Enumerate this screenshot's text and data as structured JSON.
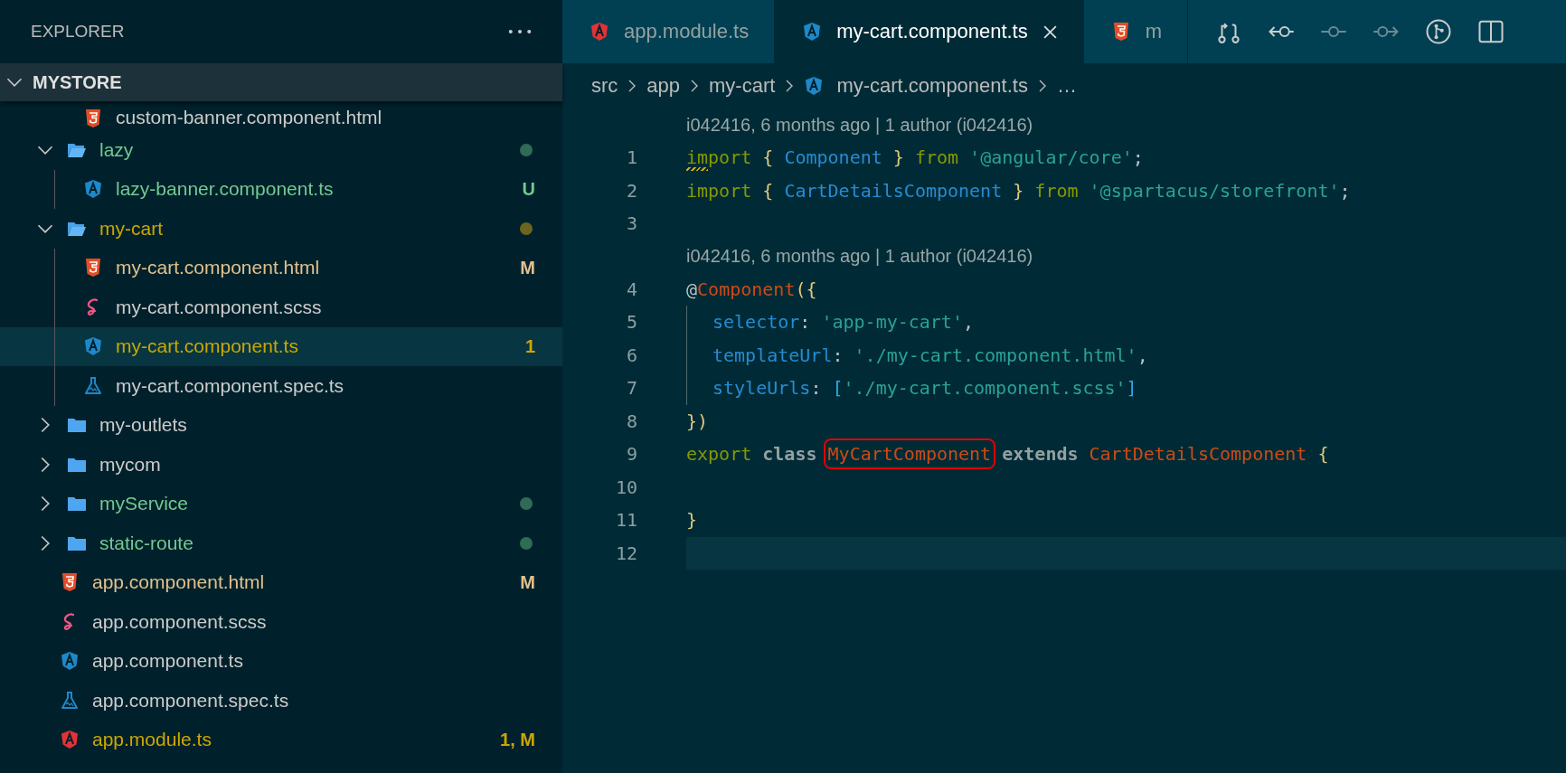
{
  "sidebar": {
    "title": "EXPLORER",
    "root": {
      "label": "MYSTORE",
      "expanded": true
    },
    "scrolled_item": {
      "label": "custom-banner.component.html",
      "kind": "html"
    },
    "tree": [
      {
        "kind": "folder",
        "label": "lazy",
        "expanded": true,
        "selected": false,
        "untracked": true,
        "modified": false,
        "has_problem": false,
        "children": [
          {
            "kind": "angular",
            "label": "lazy-banner.component.ts",
            "selected": false,
            "untracked": true,
            "modified": false,
            "has_problem": false,
            "badge": "U"
          }
        ]
      },
      {
        "kind": "folder",
        "label": "my-cart",
        "expanded": true,
        "selected": false,
        "has_problem": true,
        "children": [
          {
            "kind": "html",
            "label": "my-cart.component.html",
            "selected": false,
            "modified": true,
            "has_problem": false,
            "badge": "M"
          },
          {
            "kind": "scss",
            "label": "my-cart.component.scss",
            "selected": false,
            "untracked": false,
            "modified": false,
            "has_problem": false
          },
          {
            "kind": "angular",
            "label": "my-cart.component.ts",
            "selected": true,
            "has_problem": true,
            "badge": "1"
          },
          {
            "kind": "test",
            "label": "my-cart.component.spec.ts",
            "selected": false,
            "untracked": false,
            "modified": false,
            "has_problem": false
          }
        ]
      },
      {
        "kind": "folder",
        "label": "my-outlets",
        "expanded": false,
        "selected": false,
        "untracked": false,
        "modified": false,
        "has_problem": false
      },
      {
        "kind": "folder",
        "label": "mycom",
        "expanded": false,
        "selected": false,
        "untracked": false,
        "modified": false,
        "has_problem": false
      },
      {
        "kind": "folder",
        "label": "myService",
        "expanded": false,
        "selected": false,
        "untracked": true,
        "modified": false,
        "has_problem": false
      },
      {
        "kind": "folder",
        "label": "static-route",
        "expanded": false,
        "selected": false,
        "untracked": true,
        "modified": false,
        "has_problem": false
      },
      {
        "kind": "html",
        "label": "app.component.html",
        "selected": false,
        "modified": true,
        "has_problem": false,
        "badge": "M"
      },
      {
        "kind": "scss",
        "label": "app.component.scss",
        "selected": false,
        "untracked": false,
        "modified": false,
        "has_problem": false
      },
      {
        "kind": "angular",
        "label": "app.component.ts",
        "selected": false,
        "untracked": false,
        "modified": false,
        "has_problem": false
      },
      {
        "kind": "test",
        "label": "app.component.spec.ts",
        "selected": false,
        "untracked": false,
        "modified": false,
        "has_problem": false
      },
      {
        "kind": "angular-red",
        "label": "app.module.ts",
        "selected": false,
        "has_problem": true,
        "badge": "1, M"
      }
    ]
  },
  "tabs": [
    {
      "label": "app.module.ts",
      "kind": "angular-red",
      "selected": false
    },
    {
      "label": "my-cart.component.ts",
      "kind": "angular",
      "selected": true
    },
    {
      "label": "m",
      "kind": "html",
      "selected": false
    }
  ],
  "breadcrumb": [
    {
      "label": "src",
      "kind": "folder"
    },
    {
      "label": "app",
      "kind": "folder"
    },
    {
      "label": "my-cart",
      "kind": "folder"
    },
    {
      "label": "my-cart.component.ts",
      "kind": "angular"
    },
    {
      "label": "…",
      "kind": "more"
    }
  ],
  "editor": {
    "lines": [
      {
        "kind": "codelens",
        "text": "i042416, 6 months ago | 1 author (i042416)"
      },
      {
        "kind": "code",
        "number": "1",
        "current": false,
        "indented": false,
        "tokens": [
          {
            "text": "import",
            "kind": "keyword",
            "warn": true
          },
          {
            "text": " {",
            "kind": "brace"
          },
          {
            "text": " Component",
            "kind": "type"
          },
          {
            "text": " }",
            "kind": "brace"
          },
          {
            "text": " from",
            "kind": "keyword"
          },
          {
            "text": " '@angular/core'",
            "kind": "string"
          },
          {
            "text": ";",
            "kind": "punct"
          }
        ]
      },
      {
        "kind": "code",
        "number": "2",
        "current": false,
        "indented": false,
        "tokens": [
          {
            "text": "import",
            "kind": "keyword"
          },
          {
            "text": " {",
            "kind": "brace"
          },
          {
            "text": " CartDetailsComponent",
            "kind": "type"
          },
          {
            "text": " }",
            "kind": "brace"
          },
          {
            "text": " from",
            "kind": "keyword"
          },
          {
            "text": " '@spartacus/storefront'",
            "kind": "string"
          },
          {
            "text": ";",
            "kind": "punct"
          }
        ]
      },
      {
        "kind": "code",
        "number": "3",
        "current": false,
        "indented": false
      },
      {
        "kind": "codelens",
        "text": "i042416, 6 months ago | 1 author (i042416)"
      },
      {
        "kind": "code",
        "number": "4",
        "current": false,
        "indented": false,
        "tokens": [
          {
            "text": "@",
            "kind": "punct"
          },
          {
            "text": "Component",
            "kind": "class"
          },
          {
            "text": "({",
            "kind": "brace"
          }
        ]
      },
      {
        "kind": "code",
        "number": "5",
        "current": false,
        "indented": true,
        "tokens": [
          {
            "text": "selector",
            "kind": "property"
          },
          {
            "text": ": ",
            "kind": "punct"
          },
          {
            "text": "'app-my-cart'",
            "kind": "string"
          },
          {
            "text": ",",
            "kind": "punct"
          }
        ]
      },
      {
        "kind": "code",
        "number": "6",
        "current": false,
        "indented": true,
        "tokens": [
          {
            "text": "templateUrl",
            "kind": "property"
          },
          {
            "text": ": ",
            "kind": "punct"
          },
          {
            "text": "'./my-cart.component.html'",
            "kind": "string"
          },
          {
            "text": ",",
            "kind": "punct"
          }
        ]
      },
      {
        "kind": "code",
        "number": "7",
        "current": false,
        "indented": true,
        "tokens": [
          {
            "text": "styleUrls",
            "kind": "property"
          },
          {
            "text": ": ",
            "kind": "punct"
          },
          {
            "text": "[",
            "kind": "bracket"
          },
          {
            "text": "'./my-cart.component.scss'",
            "kind": "string"
          },
          {
            "text": "]",
            "kind": "bracket"
          }
        ]
      },
      {
        "kind": "code",
        "number": "8",
        "current": false,
        "indented": false,
        "tokens": [
          {
            "text": "})",
            "kind": "brace"
          }
        ]
      },
      {
        "kind": "code",
        "number": "9",
        "current": false,
        "indented": false,
        "tokens": [
          {
            "text": "export",
            "kind": "keyword"
          },
          {
            "text": " class ",
            "kind": "storage"
          },
          {
            "text": "MyCartComponent",
            "kind": "class",
            "highlighted": true
          },
          {
            "text": " extends",
            "kind": "storage"
          },
          {
            "text": " CartDetailsComponent",
            "kind": "class"
          },
          {
            "text": " {",
            "kind": "brace"
          }
        ]
      },
      {
        "kind": "code",
        "number": "10",
        "current": false,
        "indented": false
      },
      {
        "kind": "code",
        "number": "11",
        "current": false,
        "indented": false,
        "tokens": [
          {
            "text": "}",
            "kind": "brace"
          }
        ]
      },
      {
        "kind": "code",
        "number": "12",
        "current": true,
        "indented": false
      }
    ]
  }
}
